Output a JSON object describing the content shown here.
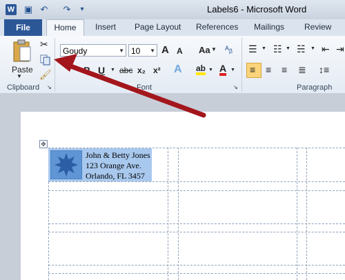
{
  "window": {
    "title": "Labels6 - Microsoft Word",
    "app_icon": "W"
  },
  "qat": {
    "save_icon": "💾",
    "undo_icon": "↶",
    "redo_icon": "↷"
  },
  "tabs": [
    {
      "label": "File"
    },
    {
      "label": "Home"
    },
    {
      "label": "Insert"
    },
    {
      "label": "Page Layout"
    },
    {
      "label": "References"
    },
    {
      "label": "Mailings"
    },
    {
      "label": "Review"
    }
  ],
  "ribbon": {
    "paste_label": "Paste",
    "clipboard_label": "Clipboard",
    "font_name": "Goudy",
    "font_size": "10",
    "font_group_label": "Font",
    "paragraph_label": "Paragraph",
    "bold": "B",
    "underline": "U",
    "strike": "abc",
    "subscript": "x₂",
    "superscript": "x²",
    "grow": "A",
    "shrink": "A",
    "change_case": "Aa",
    "effects": "A",
    "highlight": "ab",
    "font_color": "A"
  },
  "label": {
    "line1": "John & Betty Jones",
    "line2": "123 Orange Ave.",
    "line3": "Orlando, FL 3457"
  },
  "colors": {
    "accent": "#2b5797",
    "arrow": "#a3161c",
    "selection": "#a8c8ee"
  }
}
